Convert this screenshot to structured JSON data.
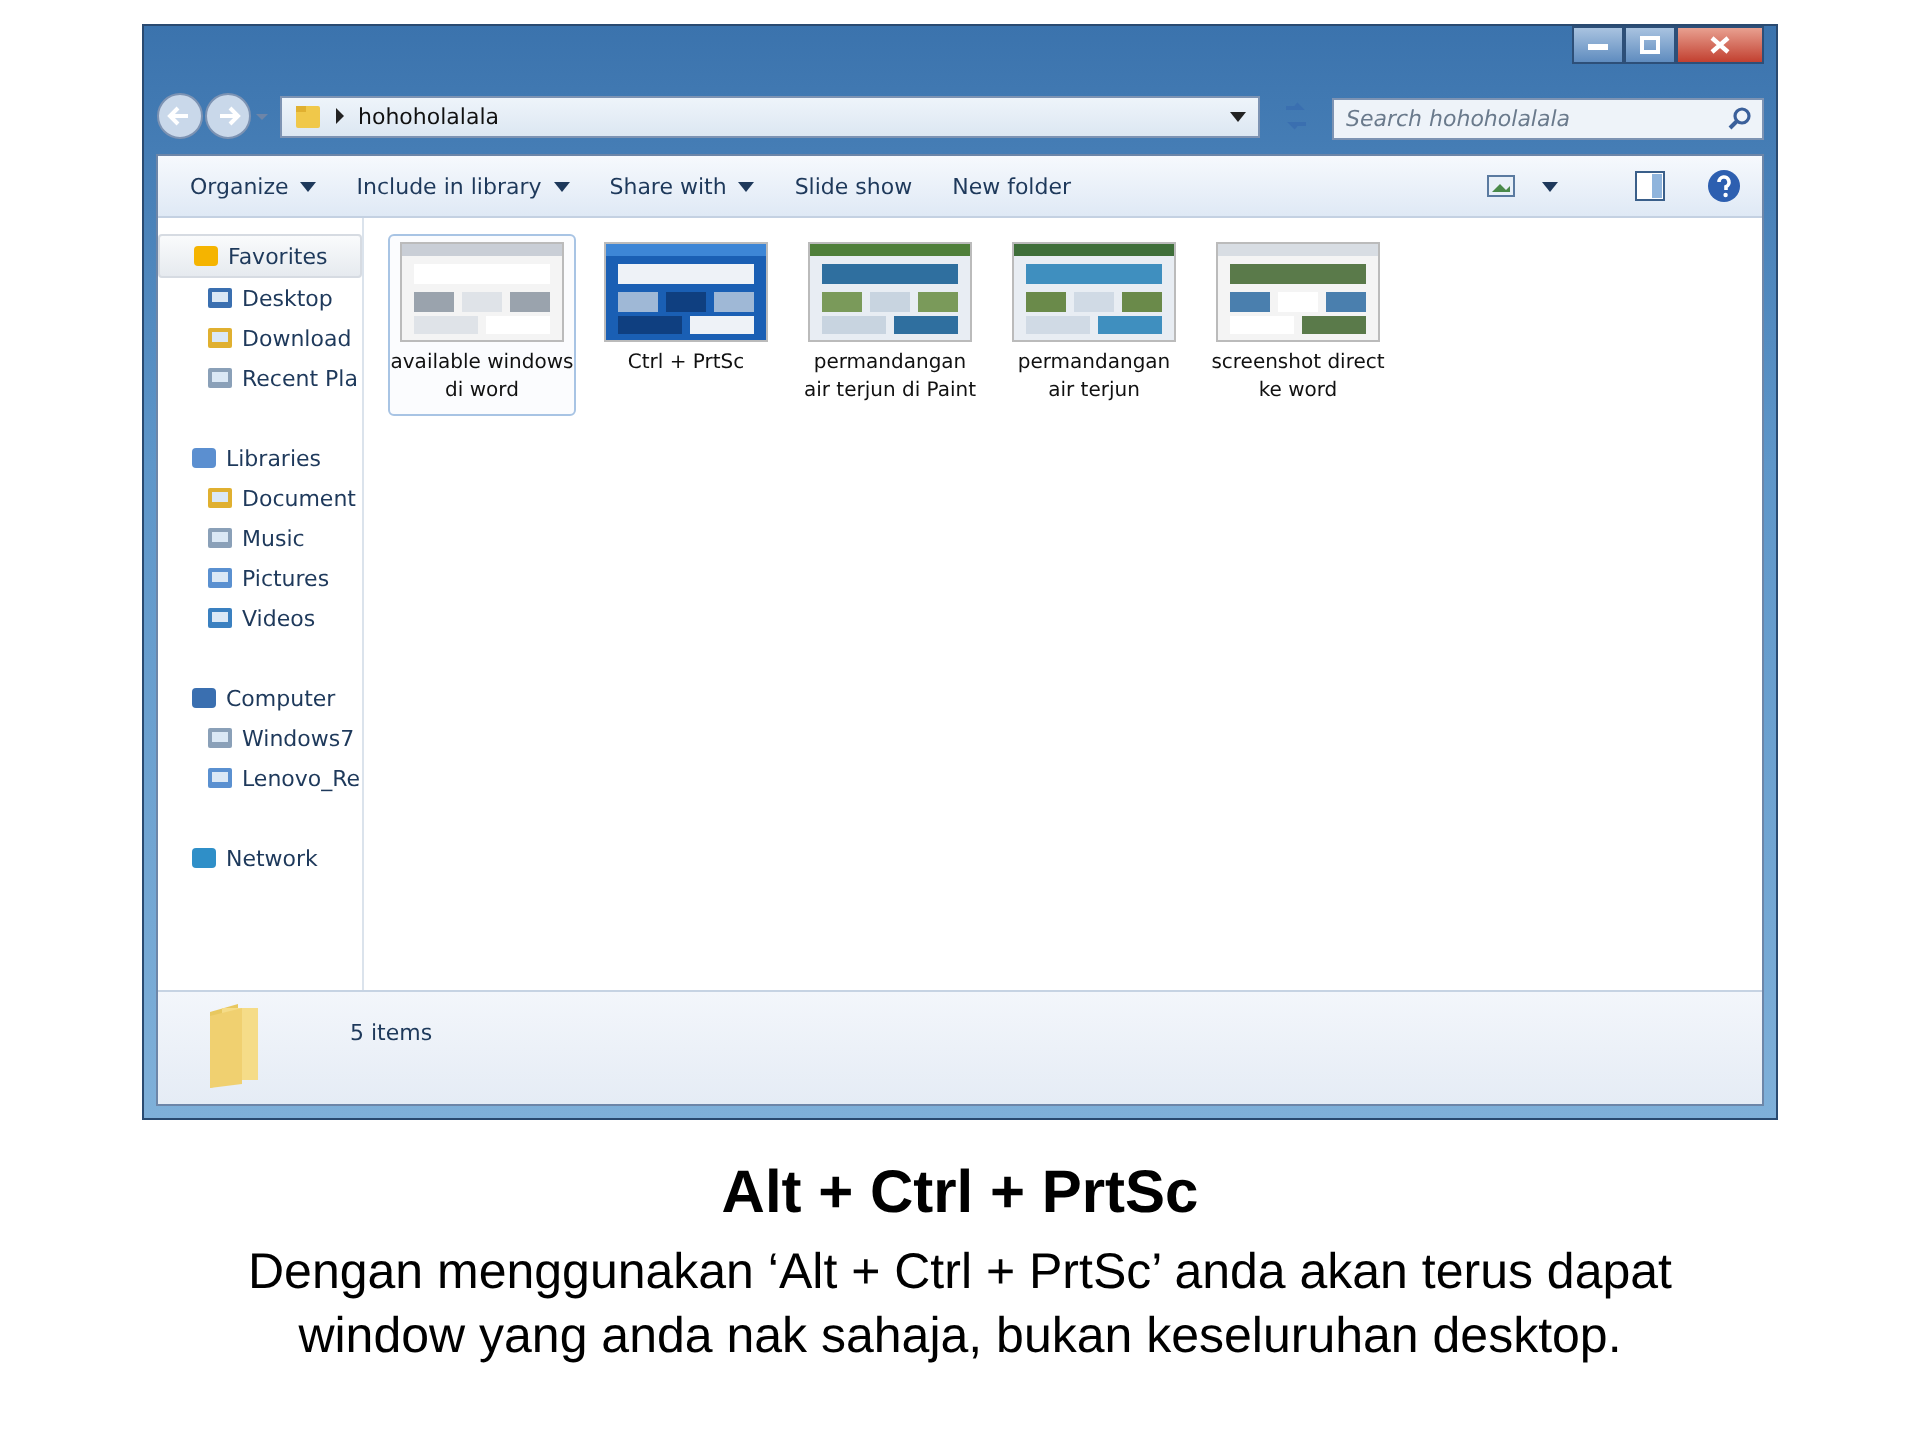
{
  "window": {
    "address": "hohoholalala",
    "search": {
      "placeholder": "Search hohoholalala"
    }
  },
  "toolbar": [
    {
      "label": "Organize",
      "dropdown": true
    },
    {
      "label": "Include in library",
      "dropdown": true
    },
    {
      "label": "Share with",
      "dropdown": true
    },
    {
      "label": "Slide show",
      "dropdown": false
    },
    {
      "label": "New folder",
      "dropdown": false
    }
  ],
  "sidebar": [
    {
      "label": "Favorites",
      "selected": true,
      "children": [
        {
          "label": "Desktop"
        },
        {
          "label": "Download"
        },
        {
          "label": "Recent Pla"
        }
      ]
    },
    {
      "label": "Libraries",
      "selected": false,
      "children": [
        {
          "label": "Document"
        },
        {
          "label": "Music"
        },
        {
          "label": "Pictures"
        },
        {
          "label": "Videos"
        }
      ]
    },
    {
      "label": "Computer",
      "selected": false,
      "children": [
        {
          "label": "Windows7"
        },
        {
          "label": "Lenovo_Re"
        }
      ]
    },
    {
      "label": "Network",
      "selected": false
    }
  ],
  "files": [
    {
      "name": "available windows di word",
      "selected": true,
      "kind": "picture"
    },
    {
      "name": "Ctrl + PrtSc",
      "selected": false,
      "kind": "picture"
    },
    {
      "name": "permandangan air terjun di Paint",
      "selected": false,
      "kind": "picture"
    },
    {
      "name": "permandangan air terjun",
      "selected": false,
      "kind": "picture"
    },
    {
      "name": "screenshot direct ke word",
      "selected": false,
      "kind": "picture"
    }
  ],
  "status_bar": {
    "text": "5 items"
  },
  "caption": {
    "title": "Alt + Ctrl + PrtSc",
    "text": "Dengan menggunakan ‘Alt + Ctrl + PrtSc’ anda akan terus dapat window yang anda nak sahaja, bukan keseluruhan desktop."
  }
}
